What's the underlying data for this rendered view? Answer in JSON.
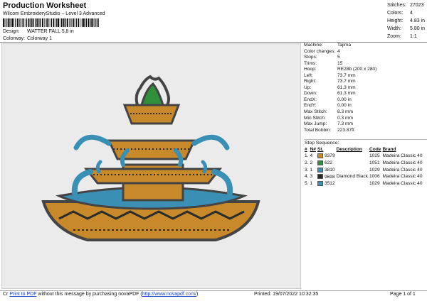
{
  "header": {
    "title": "Production Worksheet",
    "subtitle": "Wilcom EmbroideryStudio – Level 3 Advanced",
    "design_label": "Design:",
    "design_value": "WATTER FALL 5,8 in",
    "colorway_label": "Colorway:",
    "colorway_value": "Colorway 1"
  },
  "stats": [
    {
      "label": "Stitches:",
      "value": "27023"
    },
    {
      "label": "Colors:",
      "value": "4"
    },
    {
      "label": "Height:",
      "value": "4.83 in"
    },
    {
      "label": "Width:",
      "value": "5.80 in"
    },
    {
      "label": "Zoom:",
      "value": "1:1"
    }
  ],
  "machine_info": [
    {
      "label": "Machine:",
      "value": "Tajima"
    },
    {
      "label": "Color changes:",
      "value": "4"
    },
    {
      "label": "Stops:",
      "value": "5"
    },
    {
      "label": "Trims:",
      "value": "15"
    },
    {
      "label": "Hoop:",
      "value": "RE28b (200 x 280)"
    },
    {
      "label": "Left:",
      "value": "73.7 mm"
    },
    {
      "label": "Right:",
      "value": "73.7 mm"
    },
    {
      "label": "Up:",
      "value": "61.3 mm"
    },
    {
      "label": "Down:",
      "value": "61.3 mm"
    },
    {
      "label": "EndX:",
      "value": "0.00 in"
    },
    {
      "label": "EndY:",
      "value": "0.00 in"
    },
    {
      "label": "Max Stitch:",
      "value": "8.3 mm"
    },
    {
      "label": "Min Stitch:",
      "value": "0.3 mm"
    },
    {
      "label": "Max Jump:",
      "value": "7.3 mm"
    },
    {
      "label": "Total Bobbin:",
      "value": "223.87ft"
    }
  ],
  "stop_sequence": {
    "title": "Stop Sequence:",
    "headers": [
      "#",
      "N#",
      "St.",
      "Description",
      "Code",
      "Brand"
    ],
    "rows": [
      {
        "num": "1.",
        "n": "4",
        "color": "#c8892a",
        "st": "9379",
        "desc": "",
        "code": "1025",
        "brand": "Madeira Classic 40"
      },
      {
        "num": "2.",
        "n": "2",
        "color": "#2f8f3a",
        "st": "622",
        "desc": "",
        "code": "1051",
        "brand": "Madeira Classic 40"
      },
      {
        "num": "3.",
        "n": "1",
        "color": "#3a8fb5",
        "st": "3810",
        "desc": "",
        "code": "1029",
        "brand": "Madeira Classic 40"
      },
      {
        "num": "4.",
        "n": "3",
        "color": "#2a2a2a",
        "st": "9698",
        "desc": "Diamond Black",
        "code": "1006",
        "brand": "Madeira Classic 40"
      },
      {
        "num": "5.",
        "n": "1",
        "color": "#3a8fb5",
        "st": "3512",
        "desc": "",
        "code": "1029",
        "brand": "Madeira Classic 40"
      }
    ]
  },
  "footer": {
    "left_prefix": "Cr",
    "print_link": "Print to PDF",
    "left_text": " without this message by purchasing novaPDF (",
    "url": "http://www.novapdf.com/",
    "left_suffix": ")",
    "printed": "Printed: 19/07/2022 10:32:35",
    "page": "Page 1 of 1"
  },
  "colors": {
    "gold": "#c8892a",
    "green": "#2f8f3a",
    "blue": "#3a8fb5",
    "black": "#2a2a2a",
    "preview_bg": "#ebebeb"
  }
}
